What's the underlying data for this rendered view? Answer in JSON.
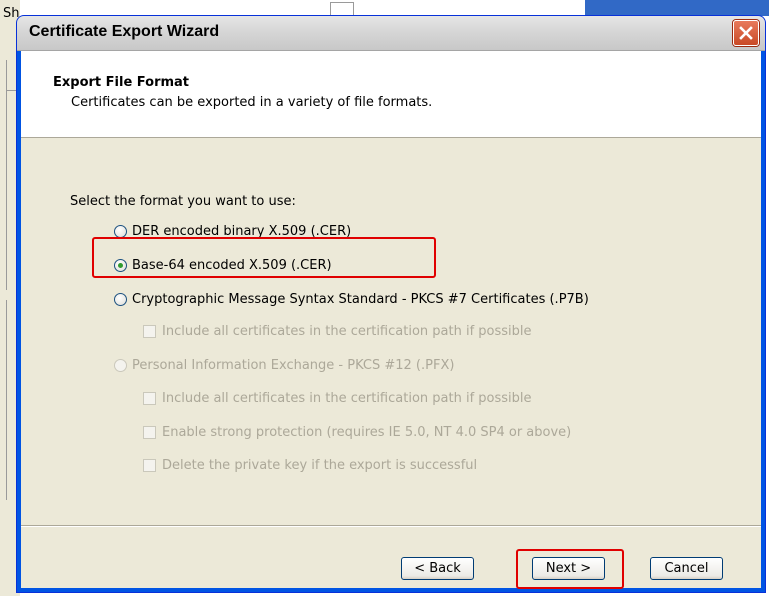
{
  "background": {
    "left_text": "Sh"
  },
  "dialog": {
    "title": "Certificate Export Wizard",
    "header_title": "Export File Format",
    "header_subtitle": "Certificates can be exported in a variety of file formats.",
    "prompt": "Select the format you want to use:",
    "options": {
      "der": "DER encoded binary X.509 (.CER)",
      "base64": "Base-64 encoded X.509 (.CER)",
      "pkcs7": "Cryptographic Message Syntax Standard - PKCS #7 Certificates (.P7B)",
      "pkcs7_include": "Include all certificates in the certification path if possible",
      "pfx": "Personal Information Exchange - PKCS #12 (.PFX)",
      "pfx_include": "Include all certificates in the certification path if possible",
      "pfx_strong": "Enable strong protection (requires IE 5.0, NT 4.0 SP4 or above)",
      "pfx_delete": "Delete the private key if the export is successful"
    },
    "selected_option": "base64",
    "buttons": {
      "back": "< Back",
      "next": "Next >",
      "cancel": "Cancel"
    }
  },
  "colors": {
    "highlight": "#e00000",
    "radio_dot": "#2f9a2f",
    "disabled_text": "#aca899"
  }
}
